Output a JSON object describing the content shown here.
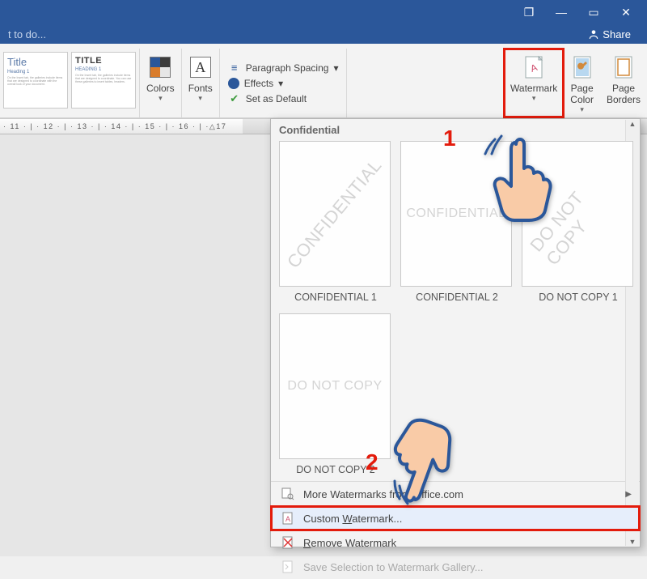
{
  "titlebar": {
    "restore": "❐",
    "minimize": "—",
    "maximize": "▭",
    "close": "✕"
  },
  "menubar": {
    "tell_me": "t to do...",
    "share": "Share"
  },
  "styles": [
    {
      "title": "Title",
      "heading": "Heading 1",
      "body": "On the Insert tab, the galleries include items that are designed to coordinate with the overall look of your document."
    },
    {
      "title": "TITLE",
      "heading": "HEADING 1",
      "body": "On the Insert tab, the galleries include items that are designed to coordinate. You can use these galleries to insert tables, headers."
    }
  ],
  "ribbon": {
    "colors": "Colors",
    "fonts": "Fonts",
    "paragraph_spacing": "Paragraph Spacing",
    "effects": "Effects",
    "set_default": "Set as Default",
    "watermark": "Watermark",
    "page_color": "Page\nColor",
    "page_borders": "Page\nBorders"
  },
  "ruler_text": " · 11 · | · 12 · | · 13 · | · 14 · | · 15 · | · 16 · | ·△17",
  "dropdown": {
    "section": "Confidential",
    "items": [
      {
        "text": "CONFIDENTIAL",
        "style": "diag",
        "label": "CONFIDENTIAL 1"
      },
      {
        "text": "CONFIDENTIAL",
        "style": "horiz",
        "label": "CONFIDENTIAL 2"
      },
      {
        "text": "DO NOT COPY",
        "style": "diag",
        "label": "DO NOT COPY 1"
      },
      {
        "text": "DO NOT COPY",
        "style": "horiz",
        "label": "DO NOT COPY 2"
      }
    ],
    "more": "More Watermarks from Office.com",
    "custom": "Custom Watermark...",
    "custom_pre": "Custom ",
    "custom_u": "W",
    "custom_post": "atermark...",
    "remove": "Remove Watermark",
    "remove_u": "R",
    "remove_post": "emove Watermark",
    "save_sel": "Save Selection to Watermark Gallery..."
  },
  "callouts": {
    "one": "1",
    "two": "2"
  }
}
